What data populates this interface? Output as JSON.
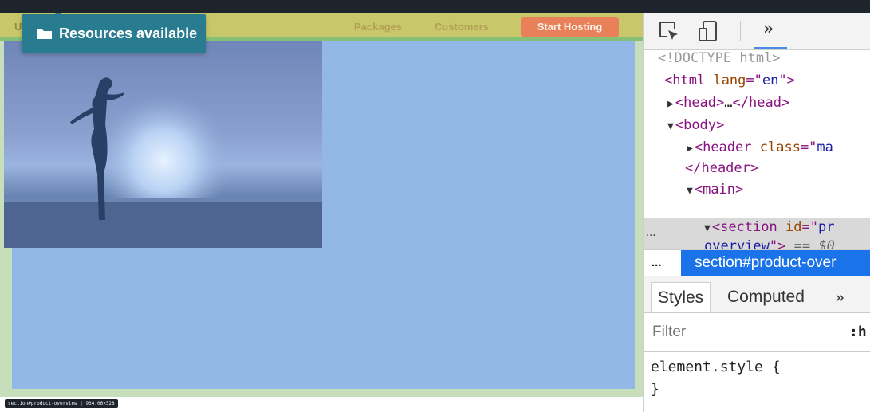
{
  "site": {
    "logo": "U",
    "nav": [
      "Packages",
      "Customers"
    ],
    "cta": "Start Hosting"
  },
  "badge": {
    "icon": "folder-icon",
    "label": "Resources available"
  },
  "size_tooltip": "section#product-overview | 934.06×528",
  "devtools": {
    "toolbar": {
      "icons": [
        "inspect-element-icon",
        "device-toolbar-icon"
      ],
      "more": "»"
    },
    "dom": {
      "doctype": "<!DOCTYPE html>",
      "html_tag": "html",
      "html_attr": "lang",
      "html_val": "en",
      "head": "head",
      "ellipsis": "…",
      "body": "body",
      "header_tag": "header",
      "header_attr": "class",
      "header_val": "ma",
      "header_close": "</header>",
      "main": "main",
      "section_tag": "section",
      "section_attr": "id",
      "section_val1": "pr",
      "section_val2": "overview",
      "selected_marker": "== $0",
      "row_dots": "..."
    },
    "breadcrumb": {
      "dots": "...",
      "item": "section#product-over"
    },
    "tabs": [
      "Styles",
      "Computed",
      "»"
    ],
    "filter": {
      "placeholder": "Filter",
      "hov": ":h"
    },
    "rules": {
      "selector": "element.style {",
      "close": "}"
    }
  }
}
